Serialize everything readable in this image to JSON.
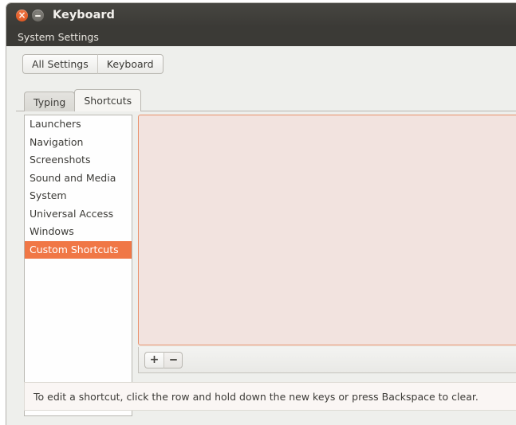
{
  "window": {
    "title": "Keyboard",
    "close_icon": "close-icon",
    "minimize_icon": "minimize-icon"
  },
  "menubar": {
    "items": [
      {
        "label": "System Settings"
      }
    ]
  },
  "toolbar": {
    "all_settings_label": "All Settings",
    "keyboard_label": "Keyboard"
  },
  "tabs": [
    {
      "label": "Typing",
      "active": false
    },
    {
      "label": "Shortcuts",
      "active": true
    }
  ],
  "sidebar": {
    "items": [
      {
        "label": "Launchers",
        "selected": false
      },
      {
        "label": "Navigation",
        "selected": false
      },
      {
        "label": "Screenshots",
        "selected": false
      },
      {
        "label": "Sound and Media",
        "selected": false
      },
      {
        "label": "System",
        "selected": false
      },
      {
        "label": "Universal Access",
        "selected": false
      },
      {
        "label": "Windows",
        "selected": false
      },
      {
        "label": "Custom Shortcuts",
        "selected": true
      }
    ]
  },
  "shortcut_list": {
    "rows": [],
    "empty": true
  },
  "list_toolbar": {
    "add_label": "+",
    "remove_label": "−",
    "add_icon": "plus-icon",
    "remove_icon": "minus-icon"
  },
  "hint": {
    "text": "To edit a shortcut, click the row and hold down the new keys or press Backspace to clear."
  },
  "colors": {
    "selection": "#f07746",
    "titlebar": "#3b3a36",
    "window_bg": "#eeefec",
    "list_panel_bg": "#f2e3df",
    "list_panel_border": "#e8906a"
  }
}
